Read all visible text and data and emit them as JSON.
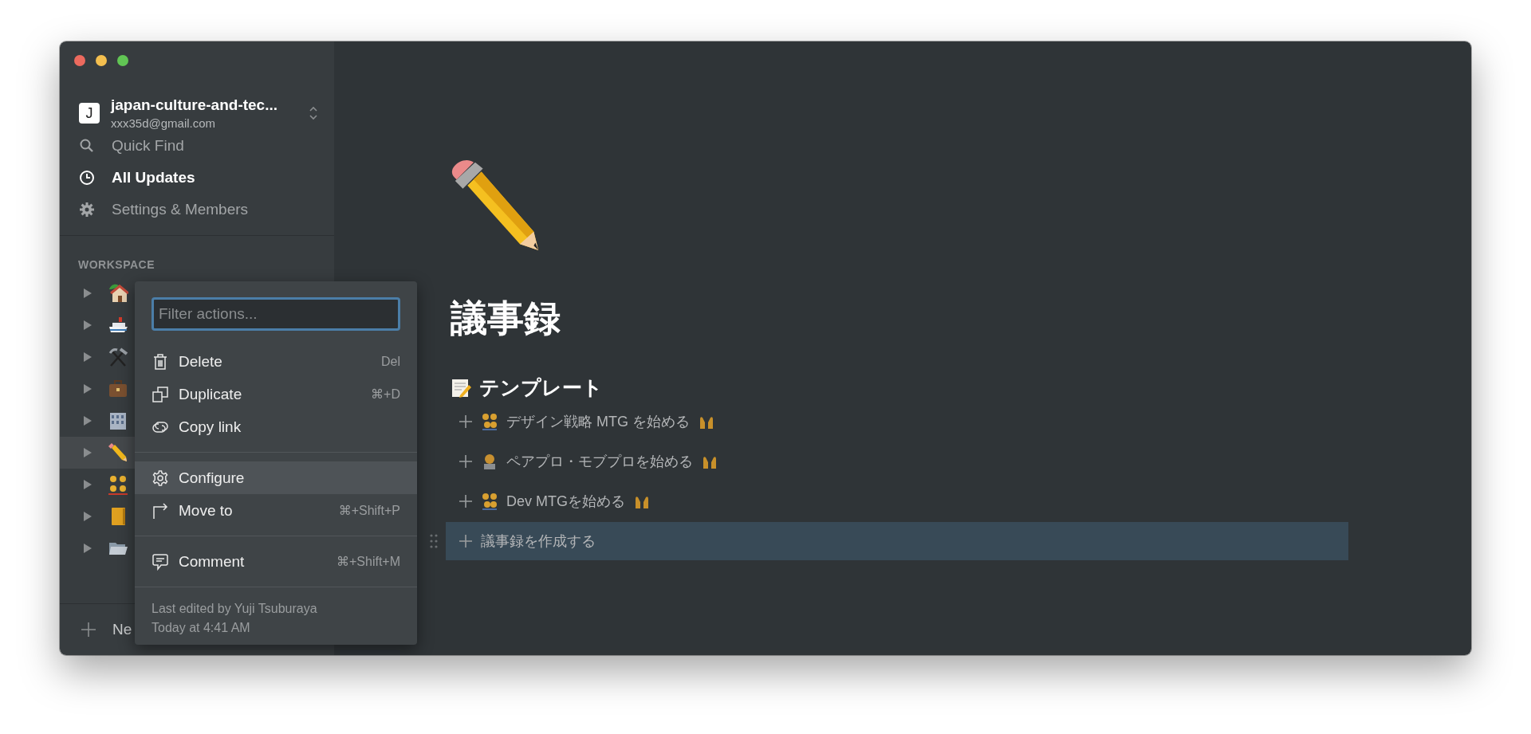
{
  "workspace": {
    "initial": "J",
    "name": "japan-culture-and-tec...",
    "email": "xxx35d@gmail.com"
  },
  "nav": [
    {
      "kind": "search",
      "label": "Quick Find",
      "active": false
    },
    {
      "kind": "clock",
      "label": "All Updates",
      "active": true
    },
    {
      "kind": "gear",
      "label": "Settings & Members",
      "active": false
    }
  ],
  "workspace_section": {
    "label": "WORKSPACE",
    "pages": [
      {
        "kind": "house",
        "selected": false
      },
      {
        "kind": "ship",
        "selected": false
      },
      {
        "kind": "tools",
        "selected": false
      },
      {
        "kind": "briefcase",
        "selected": false
      },
      {
        "kind": "building",
        "selected": false
      },
      {
        "kind": "pencil",
        "selected": true
      },
      {
        "kind": "people",
        "selected": false
      },
      {
        "kind": "book",
        "selected": false
      },
      {
        "kind": "folder",
        "selected": false
      }
    ]
  },
  "new_page": {
    "label": "Ne"
  },
  "context_menu": {
    "placeholder": "Filter actions...",
    "groups": [
      [
        {
          "kind": "trash",
          "label": "Delete",
          "shortcut": "Del",
          "highlighted": false
        },
        {
          "kind": "duplicate",
          "label": "Duplicate",
          "shortcut": "⌘+D",
          "highlighted": false
        },
        {
          "kind": "link",
          "label": "Copy link",
          "highlighted": false
        }
      ],
      [
        {
          "kind": "gear",
          "label": "Configure",
          "highlighted": true
        },
        {
          "kind": "move",
          "label": "Move to",
          "shortcut": "⌘+Shift+P",
          "highlighted": false
        }
      ],
      [
        {
          "kind": "comment",
          "label": "Comment",
          "shortcut": "⌘+Shift+M",
          "highlighted": false
        }
      ]
    ],
    "footer": [
      "Last edited by Yuji Tsuburaya",
      "Today at 4:41 AM"
    ]
  },
  "page": {
    "title": "議事録",
    "heading": {
      "kind": "memo",
      "text": "テンプレート"
    },
    "templates": [
      {
        "kind": "people",
        "text": "デザイン戦略 MTG を始める",
        "hands": true,
        "selected": false
      },
      {
        "kind": "person",
        "text": "ペアプロ・モブプロを始める",
        "hands": true,
        "selected": false
      },
      {
        "kind": "people",
        "text": "Dev MTGを始める",
        "hands": true,
        "selected": false
      },
      {
        "text": "議事録を作成する",
        "hands": false,
        "selected": true
      }
    ]
  }
}
